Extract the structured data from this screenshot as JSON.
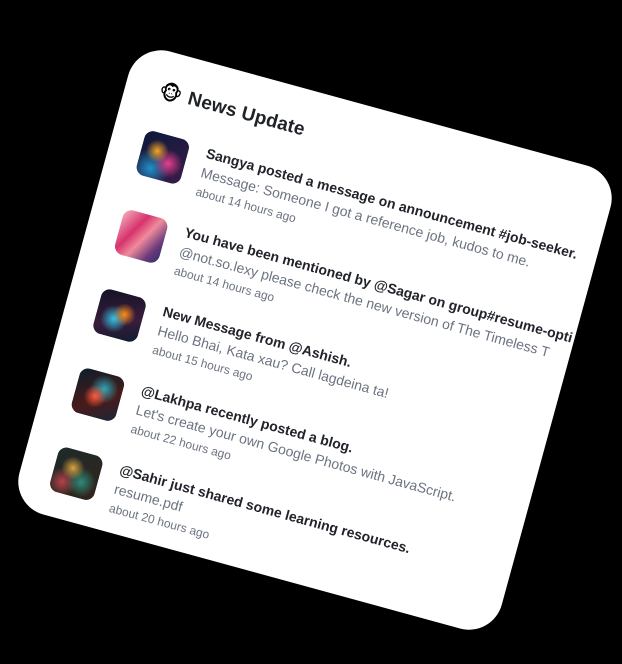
{
  "header": {
    "icon": "monkey-face-icon",
    "icon_glyph": "🐵",
    "title": "News Update"
  },
  "feed": {
    "items": [
      {
        "thumb": "abstract-swirl-thumbnail",
        "headline": "Sangya posted a message on announcement #job-seeker.",
        "message": "Message: Someone I got a reference job, kudos to me.",
        "time": "about 14 hours ago"
      },
      {
        "thumb": "pink-gradient-thumbnail",
        "headline": "You have been mentioned by @Sagar on group#resume-opti",
        "message": "@not.so.lexy please check the new version of The Timeless T",
        "time": "about 14 hours ago"
      },
      {
        "thumb": "neon-abstract-thumbnail",
        "headline": "New Message from @Ashish.",
        "message": "Hello Bhai, Kata xau? Call lagdeina ta!",
        "time": "about 15 hours ago"
      },
      {
        "thumb": "fire-abstract-thumbnail",
        "headline": "@Lakhpa recently posted a blog.",
        "message": "Let's create your own Google Photos with JavaScript.",
        "time": "about 22 hours ago"
      },
      {
        "thumb": "floral-abstract-thumbnail",
        "headline": "@Sahir just shared some learning resources.",
        "message": "resume.pdf",
        "time": "about 20 hours ago"
      }
    ]
  }
}
